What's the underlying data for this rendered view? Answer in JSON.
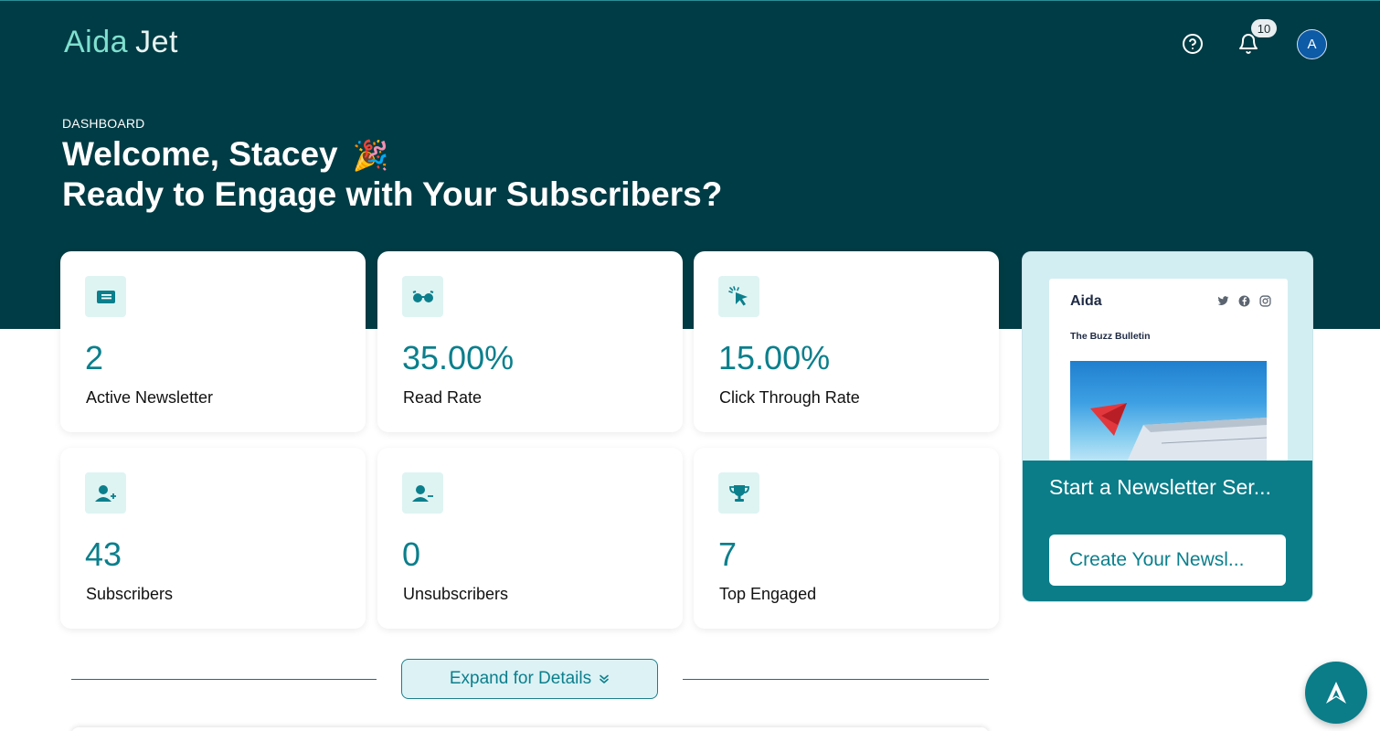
{
  "brand": {
    "logo_primary": "Aida",
    "logo_secondary": "Jet"
  },
  "header": {
    "help_icon": "help-circle-icon",
    "bell_icon": "bell-icon",
    "notification_count": "10",
    "avatar_initial": "A"
  },
  "hero": {
    "breadcrumb": "DASHBOARD",
    "welcome": "Welcome, Stacey",
    "welcome_emoji": "🎉",
    "subtitle": "Ready to Engage with Your Subscribers?"
  },
  "stats": [
    {
      "icon": "newspaper-icon",
      "value": "2",
      "label": "Active Newsletter"
    },
    {
      "icon": "glasses-icon",
      "value": "35.00%",
      "label": "Read Rate"
    },
    {
      "icon": "cursor-click-icon",
      "value": "15.00%",
      "label": "Click Through Rate"
    },
    {
      "icon": "user-plus-icon",
      "value": "43",
      "label": "Subscribers"
    },
    {
      "icon": "user-minus-icon",
      "value": "0",
      "label": "Unsubscribers"
    },
    {
      "icon": "trophy-icon",
      "value": "7",
      "label": "Top Engaged"
    }
  ],
  "promo": {
    "preview_logo": "Aida",
    "preview_title": "The Buzz Bulletin",
    "social_icons": [
      "twitter-icon",
      "facebook-icon",
      "instagram-icon"
    ],
    "title": "Start a Newsletter Ser...",
    "button_label": "Create Your Newsl..."
  },
  "expand": {
    "label": "Expand for Details",
    "icon": "double-chevron-down-icon"
  },
  "fab": {
    "icon": "aida-assistant-icon"
  },
  "colors": {
    "hero_bg": "#003c45",
    "accent": "#0b7f8c",
    "icon_bg": "#def4f3",
    "promo_bg": "#d3eef3"
  }
}
